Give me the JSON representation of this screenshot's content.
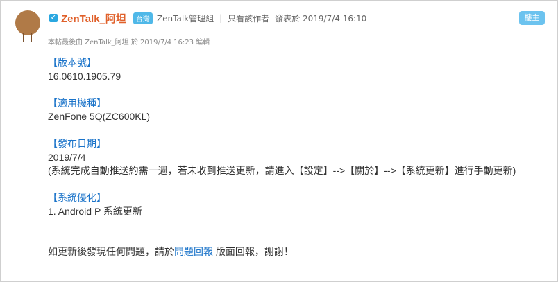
{
  "post": {
    "author": "ZenTalk_阿坦",
    "country_badge": "台灣",
    "group": "ZenTalk管理組",
    "separator": "|",
    "only_author": "只看該作者",
    "posted": "發表於 2019/7/4 16:10",
    "floor_label": "樓主",
    "edit_note": "本帖最後由 ZenTalk_阿坦 於 2019/7/4 16:23 編輯"
  },
  "content": {
    "version_heading": "【版本號】",
    "version": "16.0610.1905.79",
    "models_heading": "【適用機種】",
    "models": "ZenFone 5Q(ZC600KL)",
    "date_heading": "【發布日期】",
    "date": "2019/7/4",
    "date_note": "(系統完成自動推送約需一週，若未收到推送更新，請進入【設定】-->【關於】-->【系統更新】進行手動更新)",
    "optimization_heading": "【系統優化】",
    "optimization_item": "1. Android P 系統更新",
    "footer_prefix": "如更新後發現任何問題，請於",
    "footer_link": "問題回報",
    "footer_suffix": "版面回報，謝謝！"
  },
  "icons": {
    "verified": "verified-icon",
    "avatar": "avatar"
  },
  "colors": {
    "author": "#e0602a",
    "heading": "#1a73c9",
    "badge": "#4fb8e8",
    "floor_button": "#6cc3ef"
  }
}
